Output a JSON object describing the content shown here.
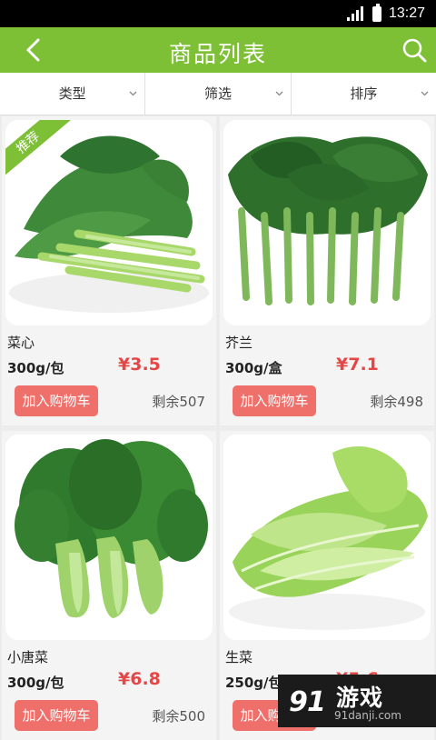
{
  "status_bar": {
    "time": "13:27"
  },
  "header": {
    "title": "商品列表"
  },
  "filters": [
    {
      "label": "类型"
    },
    {
      "label": "筛选"
    },
    {
      "label": "排序"
    }
  ],
  "products": [
    {
      "name": "菜心",
      "unit": "300g/包",
      "price": "¥3.5",
      "stock": "剩余507",
      "cart_label": "加入购物车",
      "badge": "推荐"
    },
    {
      "name": "芥兰",
      "unit": "300g/盒",
      "price": "¥7.1",
      "stock": "剩余498",
      "cart_label": "加入购物车"
    },
    {
      "name": "小唐菜",
      "unit": "300g/包",
      "price": "¥6.8",
      "stock": "剩余500",
      "cart_label": "加入购物车"
    },
    {
      "name": "生菜",
      "unit": "250g/包",
      "price": "¥5.6",
      "stock": "",
      "cart_label": "加入购物车"
    }
  ],
  "watermark": {
    "logo": "游戏",
    "site": "91danji.com"
  },
  "colors": {
    "accent": "#7dbf35",
    "price": "#e54646",
    "cart_button": "#ef6f6a"
  }
}
